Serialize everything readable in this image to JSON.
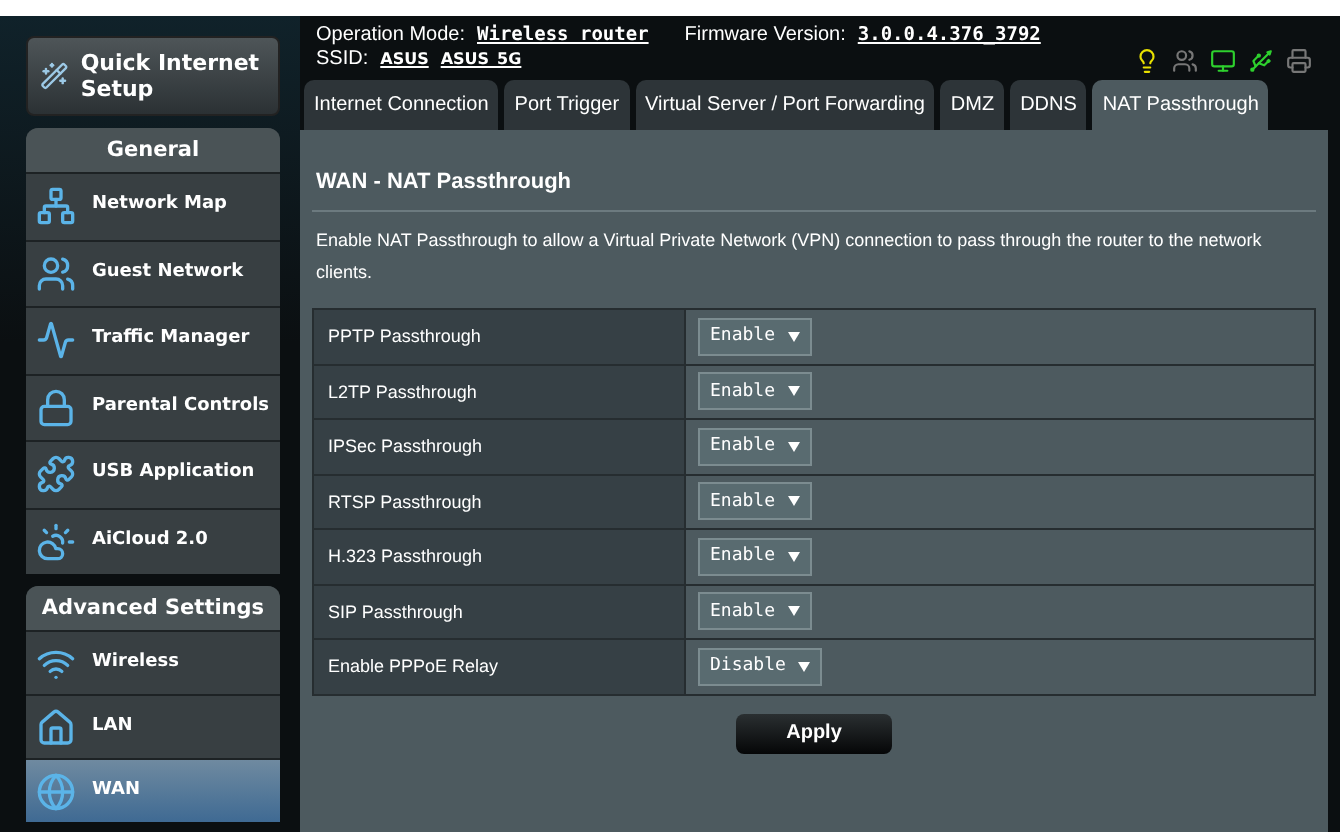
{
  "quick_setup": {
    "label": "Quick Internet Setup"
  },
  "sidebar": {
    "sections": [
      {
        "title": "General",
        "items": [
          {
            "label": "Network Map",
            "selected": false
          },
          {
            "label": "Guest Network",
            "selected": false
          },
          {
            "label": "Traffic Manager",
            "selected": false
          },
          {
            "label": "Parental Controls",
            "selected": false
          },
          {
            "label": "USB Application",
            "selected": false
          },
          {
            "label": "AiCloud 2.0",
            "selected": false
          }
        ]
      },
      {
        "title": "Advanced Settings",
        "items": [
          {
            "label": "Wireless",
            "selected": false
          },
          {
            "label": "LAN",
            "selected": false
          },
          {
            "label": "WAN",
            "selected": true
          }
        ]
      }
    ]
  },
  "header": {
    "operation_mode_label": "Operation Mode:",
    "operation_mode": "Wireless router",
    "firmware_label": "Firmware Version:",
    "firmware": "3.0.0.4.376_3792",
    "ssid_label": "SSID:",
    "ssids": [
      "ASUS",
      "ASUS_5G"
    ]
  },
  "tabs": [
    {
      "label": "Internet Connection",
      "selected": false
    },
    {
      "label": "Port Trigger",
      "selected": false
    },
    {
      "label": "Virtual Server / Port Forwarding",
      "selected": false
    },
    {
      "label": "DMZ",
      "selected": false
    },
    {
      "label": "DDNS",
      "selected": false
    },
    {
      "label": "NAT Passthrough",
      "selected": true
    }
  ],
  "page": {
    "title": "WAN - NAT Passthrough",
    "description": "Enable NAT Passthrough to allow a Virtual Private Network (VPN) connection to pass through the router to the network clients."
  },
  "settings": [
    {
      "label": "PPTP Passthrough",
      "value": "Enable"
    },
    {
      "label": "L2TP Passthrough",
      "value": "Enable"
    },
    {
      "label": "IPSec Passthrough",
      "value": "Enable"
    },
    {
      "label": "RTSP Passthrough",
      "value": "Enable"
    },
    {
      "label": "H.323 Passthrough",
      "value": "Enable"
    },
    {
      "label": "SIP Passthrough",
      "value": "Enable"
    },
    {
      "label": "Enable PPPoE Relay",
      "value": "Disable"
    }
  ],
  "apply_button": "Apply"
}
